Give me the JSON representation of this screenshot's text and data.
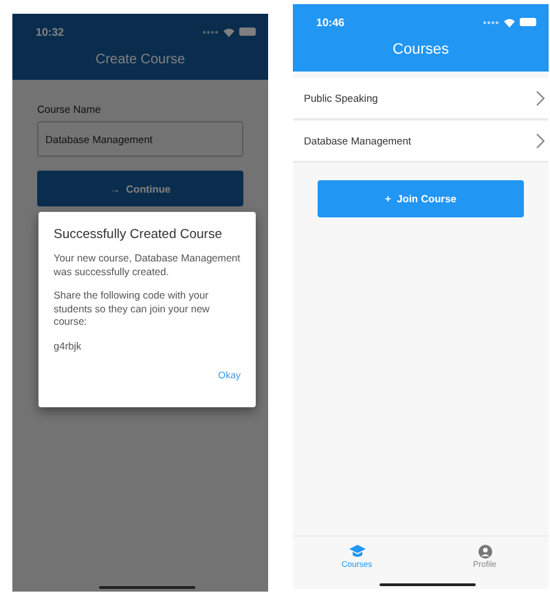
{
  "screens": [
    {
      "kind": "create",
      "status_bar": {
        "time": "10:32"
      },
      "title": "Create Course",
      "form": {
        "label": "Course Name",
        "value": "Database Management"
      },
      "button": {
        "icon": "→",
        "label": "Continue"
      },
      "dialog": {
        "title": "Successfully Created Course",
        "paragraphs": [
          "Your new course, Database Management was successfully created.",
          "Share the following code with your students so they can join your new course:",
          "g4rbjk"
        ],
        "action": "Okay"
      }
    },
    {
      "kind": "courses",
      "status_bar": {
        "time": "10:46"
      },
      "title": "Courses",
      "courses": [
        "Public Speaking",
        "Database Management"
      ],
      "button": {
        "icon": "+",
        "label": "Join Course"
      },
      "tabs": [
        {
          "label": "Courses",
          "selected": true
        },
        {
          "label": "Profile",
          "selected": false
        }
      ]
    }
  ]
}
